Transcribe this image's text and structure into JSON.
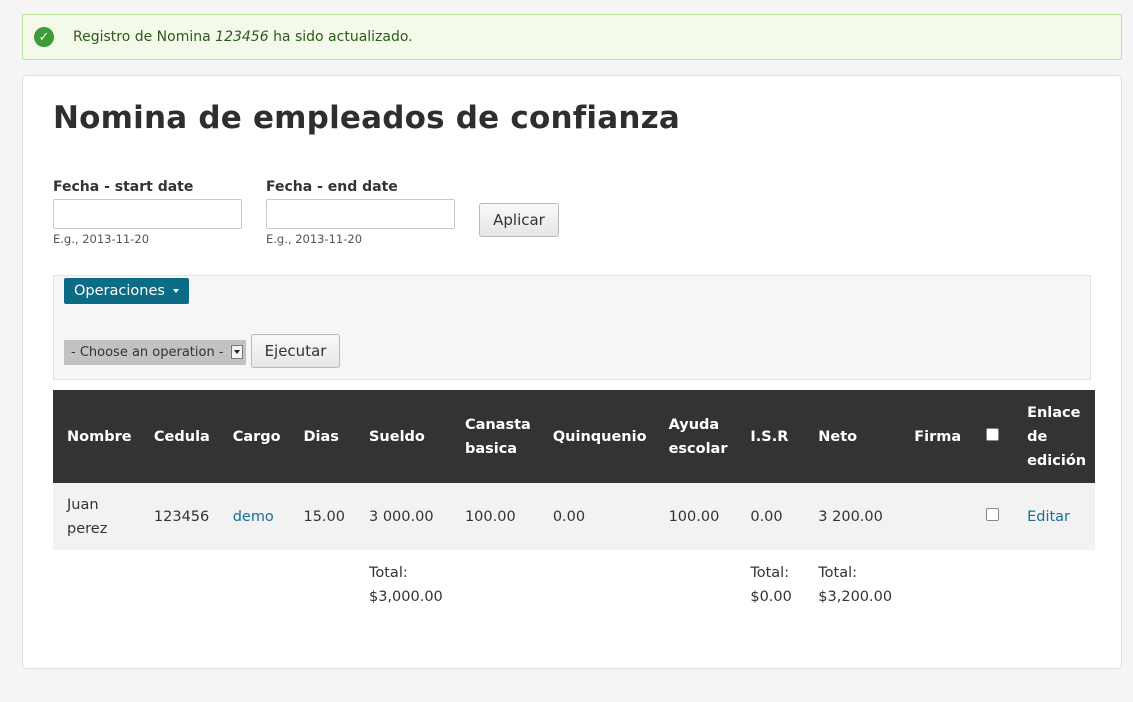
{
  "status": {
    "prefix": "Registro de Nomina",
    "id": "123456",
    "suffix": "ha sido actualizado."
  },
  "page": {
    "title": "Nomina de empleados de confianza"
  },
  "filters": {
    "start_label": "Fecha - start date",
    "start_value": "",
    "start_hint": "E.g., 2013-11-20",
    "end_label": "Fecha - end date",
    "end_value": "",
    "end_hint": "E.g., 2013-11-20",
    "apply_label": "Aplicar"
  },
  "operations": {
    "toggle_label": "Operaciones",
    "select_value": "- Choose an operation -",
    "execute_label": "Ejecutar"
  },
  "table": {
    "headers": {
      "nombre": "Nombre",
      "cedula": "Cedula",
      "cargo": "Cargo",
      "dias": "Dias",
      "sueldo": "Sueldo",
      "canasta_1": "Canasta",
      "canasta_2": "basica",
      "quinquenio": "Quinquenio",
      "ayuda_1": "Ayuda",
      "ayuda_2": "escolar",
      "isr": "I.S.R",
      "neto": "Neto",
      "firma": "Firma",
      "enlace_1": "Enlace",
      "enlace_2": "de",
      "enlace_3": "edición"
    },
    "rows": [
      {
        "nombre_1": "Juan",
        "nombre_2": "perez",
        "cedula": "123456",
        "cargo": "demo",
        "dias": "15.00",
        "sueldo": "3 000.00",
        "canasta": "100.00",
        "quinquenio": "0.00",
        "ayuda": "100.00",
        "isr": "0.00",
        "neto": "3 200.00",
        "firma": "",
        "edit": "Editar"
      }
    ],
    "totals": {
      "label": "Total:",
      "sueldo": "$3,000.00",
      "isr": "$0.00",
      "neto": "$3,200.00"
    }
  },
  "colors": {
    "accent": "#0c6b85",
    "link": "#1a6e97",
    "header_bg": "#333333",
    "success": "#3d9b3a"
  },
  "icons": {
    "status": "check-circle-icon"
  }
}
